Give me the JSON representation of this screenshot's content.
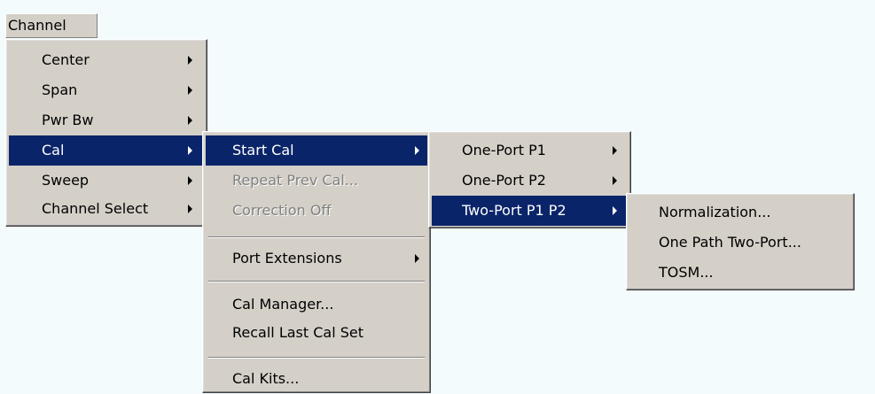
{
  "menubar": {
    "channel_label": "Channel"
  },
  "channel_menu": {
    "center": "Center",
    "span": "Span",
    "pwr_bw": "Pwr Bw",
    "cal": "Cal",
    "sweep": "Sweep",
    "channel_select": "Channel Select"
  },
  "cal_menu": {
    "start_cal": "Start Cal",
    "repeat_prev_cal": "Repeat Prev Cal...",
    "correction_off": "Correction Off",
    "port_extensions": "Port Extensions",
    "cal_manager": "Cal Manager...",
    "recall_last_cal_set": "Recall Last Cal Set",
    "cal_kits": "Cal Kits..."
  },
  "start_cal_menu": {
    "one_port_p1": "One-Port P1",
    "one_port_p2": "One-Port P2",
    "two_port_p1_p2": "Two-Port P1 P2"
  },
  "two_port_menu": {
    "normalization": "Normalization...",
    "one_path_two_port": "One Path Two-Port...",
    "tosm": "TOSM..."
  },
  "colors": {
    "menu_background": "#d4d0c8",
    "selection_background": "#0a246a",
    "disabled_text": "#808080",
    "page_background": "#f3fbfd"
  },
  "icons": [
    "submenu-arrow-icon"
  ]
}
